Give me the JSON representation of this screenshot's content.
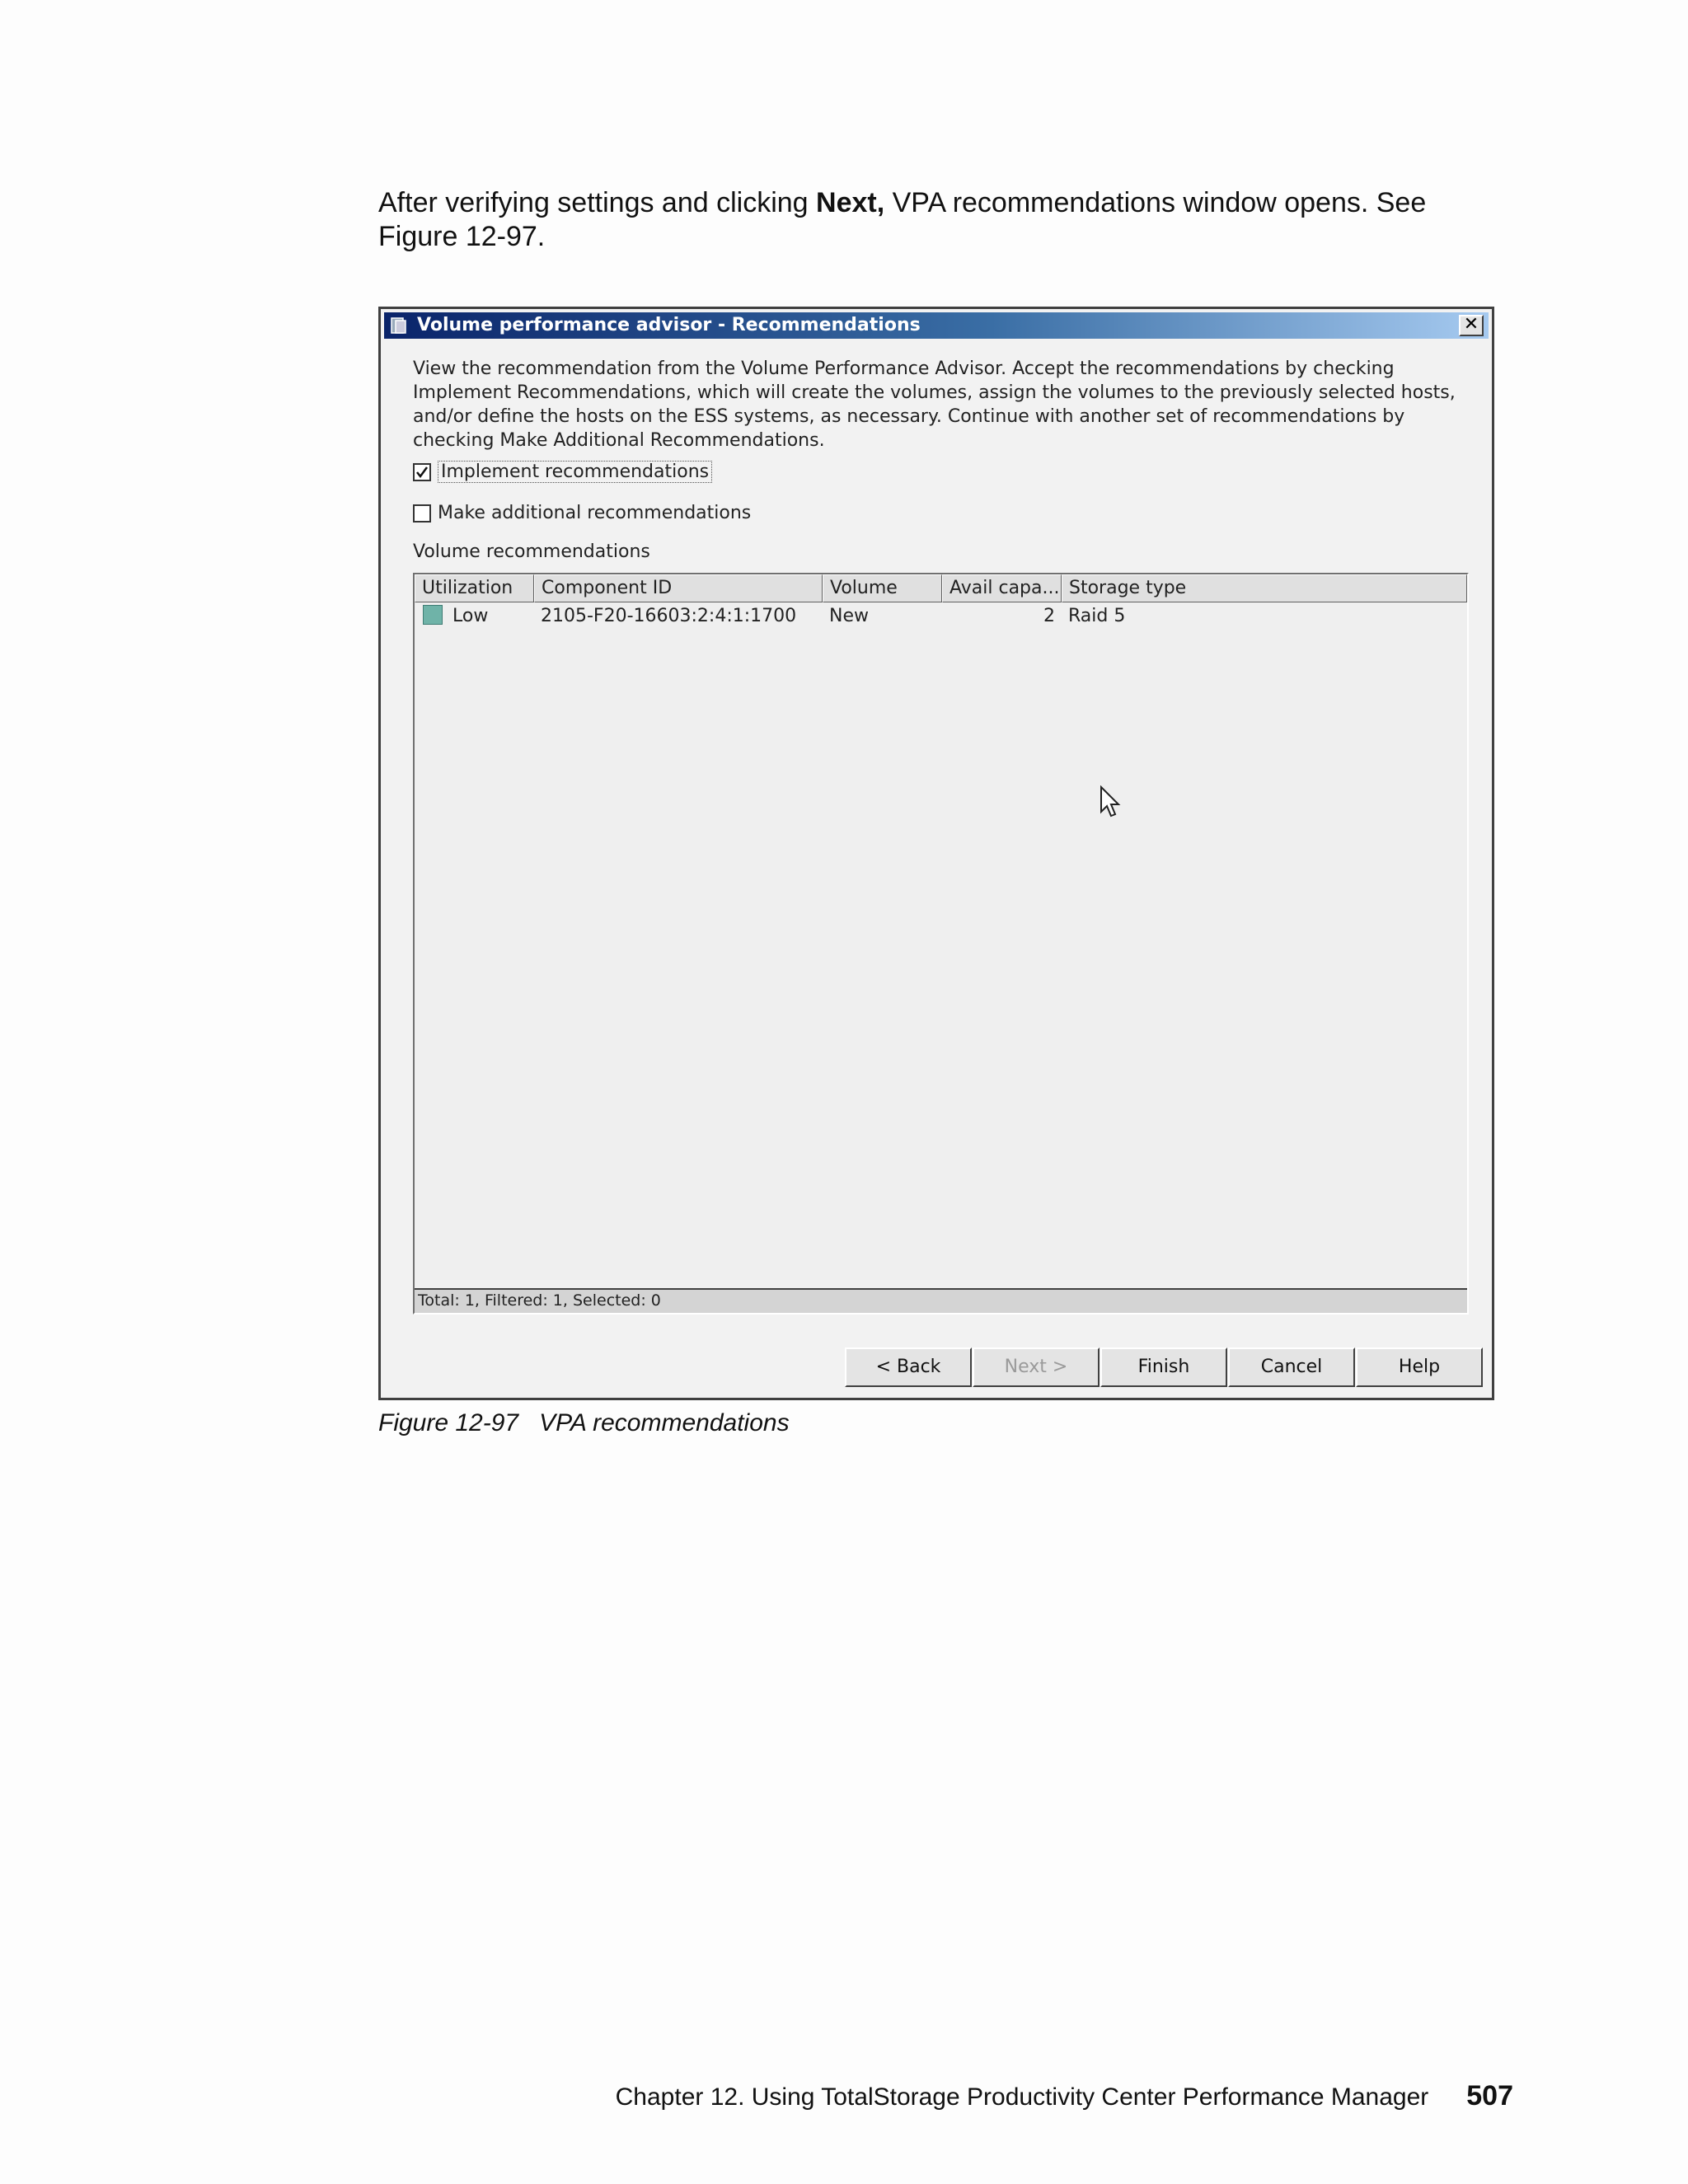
{
  "intro": {
    "before": "After verifying settings and clicking ",
    "bold": "Next,",
    "after": " VPA recommendations window opens. See Figure 12-97."
  },
  "dialog": {
    "title": "Volume performance advisor - Recommendations",
    "close_label": "✕",
    "description": "View the recommendation from the Volume Performance Advisor.  Accept the recommendations by checking Implement Recommendations, which will create the volumes, assign the volumes to the previously selected hosts, and/or define the hosts on the ESS systems, as necessary. Continue with another set of recommendations by checking Make Additional Recommendations.",
    "implement": {
      "label": "Implement recommendations",
      "checked": true
    },
    "additional": {
      "label": "Make additional recommendations",
      "checked": false
    },
    "section_label": "Volume recommendations",
    "table": {
      "columns": [
        "Utilization",
        "Component ID",
        "Volume",
        "Avail capa...",
        "Storage type"
      ],
      "rows": [
        {
          "utilization": "Low",
          "component_id": "2105-F20-16603:2:4:1:1700",
          "volume": "New",
          "avail": "2",
          "storage_type": "Raid 5",
          "swatch_color": "#6fb3a8"
        }
      ],
      "status": "Total: 1, Filtered: 1, Selected: 0"
    },
    "buttons": {
      "back": "< Back",
      "next": "Next >",
      "finish": "Finish",
      "cancel": "Cancel",
      "help": "Help"
    }
  },
  "caption": "Figure 12-97   VPA recommendations",
  "footer": {
    "chapter": "Chapter 12. Using TotalStorage Productivity Center Performance Manager",
    "page": "507"
  }
}
